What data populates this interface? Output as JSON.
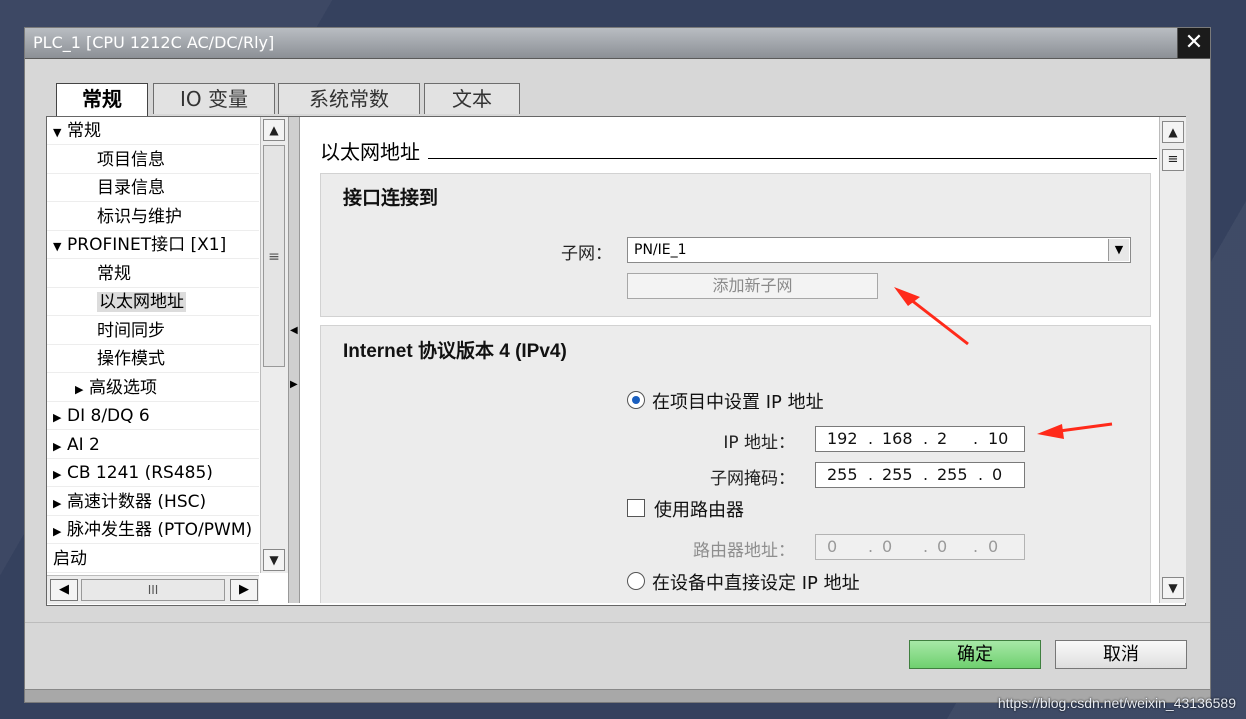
{
  "window": {
    "title": "PLC_1 [CPU 1212C AC/DC/Rly]"
  },
  "tabs": [
    {
      "label": "常规"
    },
    {
      "label": "IO 变量"
    },
    {
      "label": "系统常数"
    },
    {
      "label": "文本"
    }
  ],
  "tree": {
    "items": [
      {
        "label": "常规",
        "level": 0,
        "expander": "expanded"
      },
      {
        "label": "项目信息",
        "level": 2,
        "expander": "none"
      },
      {
        "label": "目录信息",
        "level": 2,
        "expander": "none"
      },
      {
        "label": "标识与维护",
        "level": 2,
        "expander": "none"
      },
      {
        "label": "PROFINET接口 [X1]",
        "level": 0,
        "expander": "expanded"
      },
      {
        "label": "常规",
        "level": 2,
        "expander": "none"
      },
      {
        "label": "以太网地址",
        "level": 2,
        "expander": "none",
        "selected": true
      },
      {
        "label": "时间同步",
        "level": 2,
        "expander": "none"
      },
      {
        "label": "操作模式",
        "level": 2,
        "expander": "none"
      },
      {
        "label": "高级选项",
        "level": 1,
        "expander": "collapsed"
      },
      {
        "label": "DI 8/DQ 6",
        "level": 0,
        "expander": "collapsed"
      },
      {
        "label": "AI 2",
        "level": 0,
        "expander": "collapsed"
      },
      {
        "label": "CB 1241 (RS485)",
        "level": 0,
        "expander": "collapsed"
      },
      {
        "label": "高速计数器 (HSC)",
        "level": 0,
        "expander": "collapsed"
      },
      {
        "label": "脉冲发生器 (PTO/PWM)",
        "level": 0,
        "expander": "collapsed"
      },
      {
        "label": "启动",
        "level": 0,
        "expander": "none"
      }
    ]
  },
  "content": {
    "section_title": "以太网地址",
    "interface": {
      "title": "接口连接到",
      "subnet_label": "子网：",
      "subnet_value": "PN/IE_1",
      "add_subnet_button": "添加新子网"
    },
    "ipv4": {
      "title": "Internet 协议版本 4 (IPv4)",
      "set_in_project_label": "在项目中设置 IP 地址",
      "set_in_project_selected": true,
      "ip_label": "IP 地址：",
      "ip": [
        "192",
        "168",
        "2",
        "10"
      ],
      "mask_label": "子网掩码：",
      "mask": [
        "255",
        "255",
        "255",
        "0"
      ],
      "use_router_label": "使用路由器",
      "use_router_checked": false,
      "router_label": "路由器地址：",
      "router": [
        "0",
        "0",
        "0",
        "0"
      ],
      "set_on_device_label": "在设备中直接设定 IP 地址"
    }
  },
  "footer": {
    "ok_label": "确定",
    "cancel_label": "取消"
  },
  "watermark": "https://blog.csdn.net/weixin_43136589",
  "colors": {
    "annotation_arrow": "#ff2a1a",
    "ok_button": "#7dd87d",
    "radio_dot": "#1a5fbf"
  }
}
